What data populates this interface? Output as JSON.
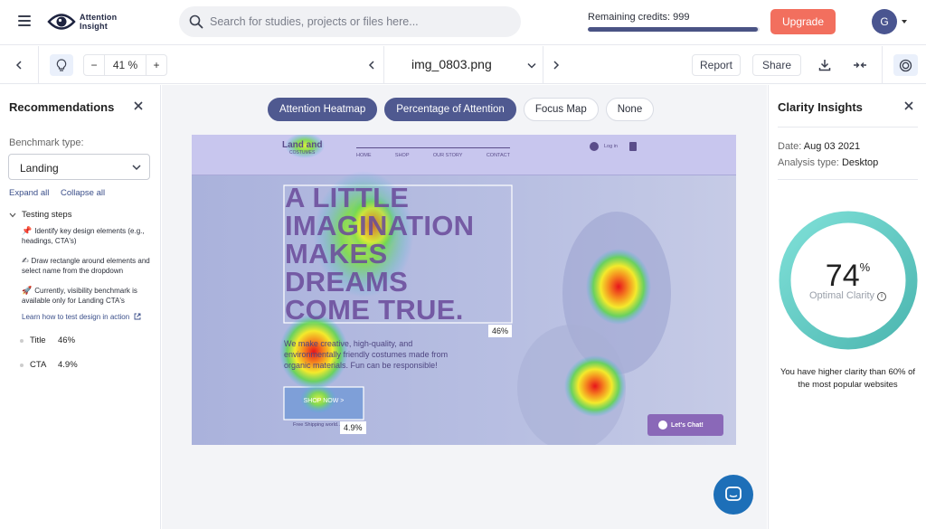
{
  "app": {
    "logo_line1": "Attention",
    "logo_line2": "Insight"
  },
  "search": {
    "placeholder": "Search for studies, projects or files here..."
  },
  "credits": {
    "label": "Remaining credits: 999",
    "fill_percent": 99
  },
  "header": {
    "upgrade_label": "Upgrade",
    "avatar_initial": "G"
  },
  "toolbar": {
    "zoom_minus": "−",
    "zoom_value": "41 %",
    "zoom_plus": "+",
    "file_name": "img_0803.png",
    "report_label": "Report",
    "share_label": "Share"
  },
  "left_panel": {
    "title": "Recommendations",
    "benchmark_label": "Benchmark type:",
    "benchmark_value": "Landing",
    "expand_all": "Expand all",
    "collapse_all": "Collapse all",
    "steps_title": "Testing steps",
    "steps": [
      {
        "emoji": "📌",
        "text": "Identify key design elements (e.g., headings, CTA's)"
      },
      {
        "emoji": "✍",
        "text": "Draw rectangle around elements and select name from the dropdown"
      },
      {
        "emoji": "🚀",
        "text": "Currently, visibility benchmark is available only for Landing CTA's"
      }
    ],
    "learn_link": "Learn how to test design in action",
    "metrics": [
      {
        "name": "Title",
        "value": "46%"
      },
      {
        "name": "CTA",
        "value": "4.9%"
      }
    ]
  },
  "view_tabs": [
    {
      "label": "Attention Heatmap",
      "active": true
    },
    {
      "label": "Percentage of Attention",
      "active": true
    },
    {
      "label": "Focus Map",
      "active": false
    },
    {
      "label": "None",
      "active": false
    }
  ],
  "canvas": {
    "site_logo": "Land   and",
    "site_logo_sub": "COSTUMES",
    "nav": [
      "HOME",
      "SHOP",
      "OUR STORY",
      "CONTACT"
    ],
    "login": "Log in",
    "headline": [
      "A LITTLE",
      "IMAGINATION",
      "MAKES",
      "DREAMS",
      "COME TRUE."
    ],
    "body": [
      "We make creative, high-quality, and",
      "environmentally friendly costumes made from",
      "organic materials. Fun can be responsible!"
    ],
    "cta": "SHOP NOW  >",
    "shipping": "Free Shipping world...",
    "chat": "Let's Chat!",
    "title_pct": "46%",
    "cta_pct": "4.9%"
  },
  "right_panel": {
    "title": "Clarity Insights",
    "date_label": "Date:",
    "date_value": "Aug 03 2021",
    "analysis_label": "Analysis type:",
    "analysis_value": "Desktop",
    "clarity_value": "74",
    "clarity_unit": "%",
    "clarity_label": "Optimal Clarity",
    "info_glyph": "i",
    "summary": "You have higher clarity than 60% of the most popular websites"
  },
  "colors": {
    "accent": "#4f5990",
    "upgrade": "#f26f5e",
    "ring": "#5ccfc4",
    "link": "#3b4f8a",
    "chat_fab": "#1d6fb8"
  },
  "icons": [
    "menu-icon",
    "eye-logo-icon",
    "search-icon",
    "chevron-left-icon",
    "lightbulb-icon",
    "chevron-right-icon",
    "chevron-down-icon",
    "download-icon",
    "collapse-arrows-icon",
    "target-icon",
    "close-icon",
    "external-link-icon",
    "chat-icon",
    "info-icon"
  ]
}
